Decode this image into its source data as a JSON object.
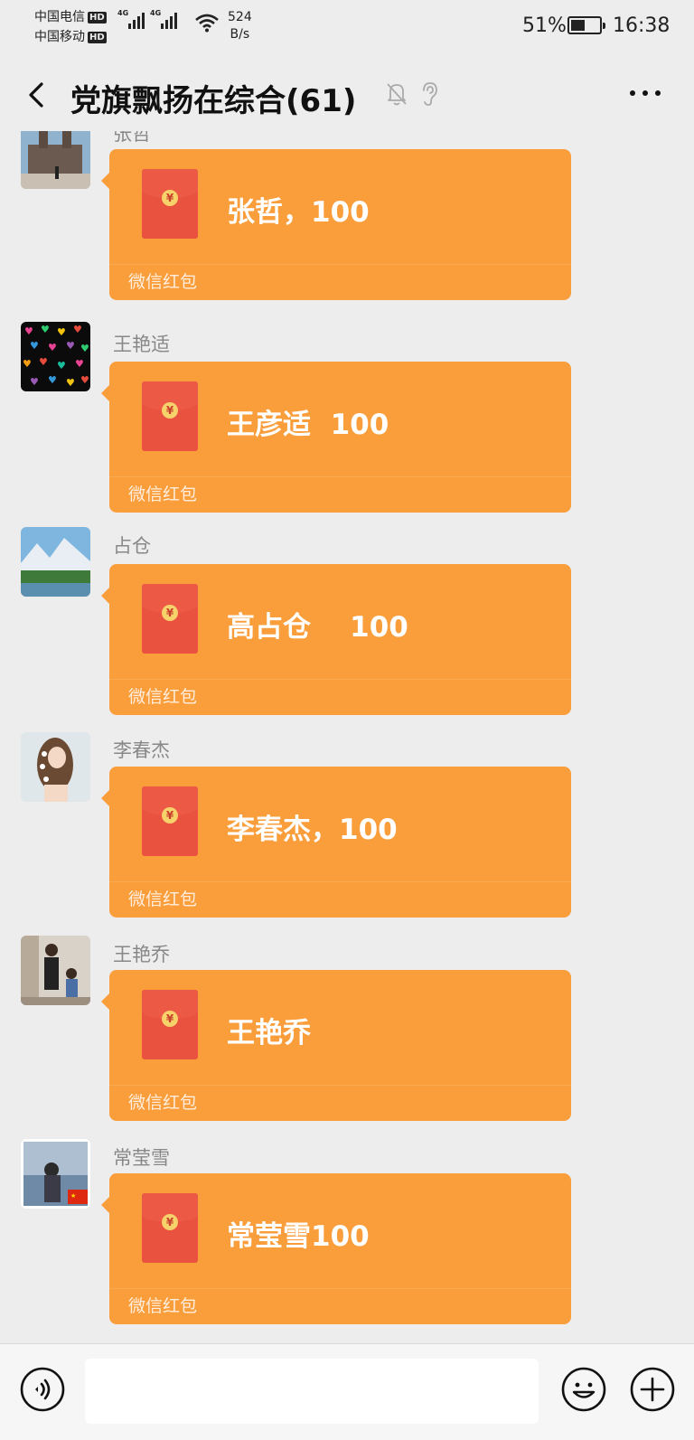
{
  "status_bar": {
    "carrier_1": "中国电信",
    "carrier_2": "中国移动",
    "hd_label": "HD",
    "network_1": "4G",
    "network_2": "4G",
    "net_speed_value": "524",
    "net_speed_unit": "B/s",
    "battery_percent": "51%",
    "battery_level": 0.51,
    "time": "16:38"
  },
  "header": {
    "title": "党旗飘扬在综合(61)",
    "icons": [
      "back-icon",
      "mute-bell-icon",
      "ear-icon",
      "more-icon"
    ]
  },
  "messages": [
    {
      "sender": "张哲",
      "greeting": "张哲，100",
      "label": "微信红包",
      "avatar": "avatar-building-photo"
    },
    {
      "sender": "王艳适",
      "greeting": "王彦适  100",
      "label": "微信红包",
      "avatar": "avatar-hearts"
    },
    {
      "sender": "占仓",
      "greeting": "高占仓    100",
      "label": "微信红包",
      "avatar": "avatar-mountain-lake"
    },
    {
      "sender": "李春杰",
      "greeting": "李春杰，100",
      "label": "微信红包",
      "avatar": "avatar-girl-flowers"
    },
    {
      "sender": "王艳乔",
      "greeting": "王艳乔",
      "label": "微信红包",
      "avatar": "avatar-family-photo"
    },
    {
      "sender": "常莹雪",
      "greeting": "常莹雪100",
      "label": "微信红包",
      "avatar": "avatar-sea-flag"
    }
  ],
  "input_bar": {
    "placeholder": "",
    "icons": [
      "voice-icon",
      "emoji-icon",
      "plus-icon"
    ]
  },
  "colors": {
    "background": "#ededed",
    "red_packet": "#fa9d3b",
    "envelope": "#e8523f",
    "coin": "#f7d26b"
  }
}
